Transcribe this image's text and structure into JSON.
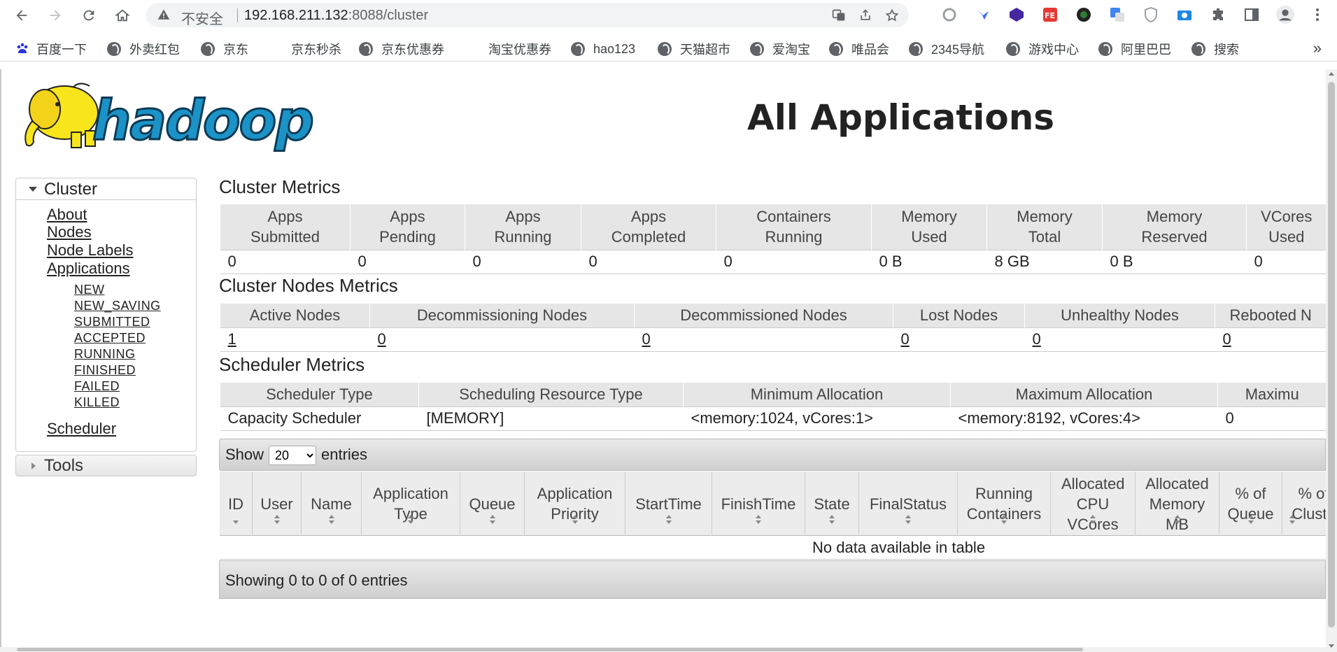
{
  "browser": {
    "security_label": "不安全",
    "url_host": "192.168.211.132",
    "url_rest": ":8088/cluster",
    "bookmarks": [
      {
        "label": "百度一下",
        "icon": "baidu-paw-icon"
      },
      {
        "label": "外卖红包",
        "icon": "globe-icon"
      },
      {
        "label": "京东",
        "icon": "globe-icon"
      },
      {
        "label": "京东秒杀",
        "icon": "none"
      },
      {
        "label": "京东优惠券",
        "icon": "globe-icon"
      },
      {
        "label": "淘宝优惠券",
        "icon": "none"
      },
      {
        "label": "hao123",
        "icon": "globe-icon"
      },
      {
        "label": "天猫超市",
        "icon": "globe-icon"
      },
      {
        "label": "爱淘宝",
        "icon": "globe-icon"
      },
      {
        "label": "唯品会",
        "icon": "globe-icon"
      },
      {
        "label": "2345导航",
        "icon": "globe-icon"
      },
      {
        "label": "游戏中心",
        "icon": "globe-icon"
      },
      {
        "label": "阿里巴巴",
        "icon": "globe-icon"
      },
      {
        "label": "搜索",
        "icon": "globe-icon"
      }
    ],
    "bookmarks_more": "»"
  },
  "page": {
    "logo_text": "hadoop",
    "title": "All Applications"
  },
  "sidebar": {
    "cluster_label": "Cluster",
    "links": [
      "About",
      "Nodes",
      "Node Labels",
      "Applications"
    ],
    "app_states": [
      "NEW",
      "NEW_SAVING",
      "SUBMITTED",
      "ACCEPTED",
      "RUNNING",
      "FINISHED",
      "FAILED",
      "KILLED"
    ],
    "scheduler_link": "Scheduler",
    "tools_label": "Tools"
  },
  "cluster_metrics": {
    "title": "Cluster Metrics",
    "headers": [
      [
        "Apps",
        "Submitted"
      ],
      [
        "Apps",
        "Pending"
      ],
      [
        "Apps",
        "Running"
      ],
      [
        "Apps",
        "Completed"
      ],
      [
        "Containers",
        "Running"
      ],
      [
        "Memory",
        "Used"
      ],
      [
        "Memory",
        "Total"
      ],
      [
        "Memory",
        "Reserved"
      ],
      [
        "VCores",
        "Used"
      ]
    ],
    "values": [
      "0",
      "0",
      "0",
      "0",
      "0",
      "0 B",
      "8 GB",
      "0 B",
      "0"
    ]
  },
  "node_metrics": {
    "title": "Cluster Nodes Metrics",
    "headers": [
      "Active Nodes",
      "Decommissioning Nodes",
      "Decommissioned Nodes",
      "Lost Nodes",
      "Unhealthy Nodes",
      "Rebooted N"
    ],
    "values": [
      "1",
      "0",
      "0",
      "0",
      "0",
      "0"
    ]
  },
  "scheduler_metrics": {
    "title": "Scheduler Metrics",
    "headers": [
      "Scheduler Type",
      "Scheduling Resource Type",
      "Minimum Allocation",
      "Maximum Allocation",
      "Maximu"
    ],
    "values": [
      "Capacity Scheduler",
      "[MEMORY]",
      "<memory:1024, vCores:1>",
      "<memory:8192, vCores:4>",
      "0"
    ]
  },
  "apps_table": {
    "show_label": "Show",
    "entries_label": "entries",
    "page_size": "20",
    "page_size_options": [
      "20"
    ],
    "columns": [
      {
        "label": "ID",
        "sort": "desc"
      },
      {
        "label": "User",
        "sort": "both"
      },
      {
        "label": "Name",
        "sort": "both"
      },
      {
        "label": "Application Type",
        "sort": "both"
      },
      {
        "label": "Queue",
        "sort": "both"
      },
      {
        "label": "Application Priority",
        "sort": "both"
      },
      {
        "label": "StartTime",
        "sort": "both"
      },
      {
        "label": "FinishTime",
        "sort": "both"
      },
      {
        "label": "State",
        "sort": "both"
      },
      {
        "label": "FinalStatus",
        "sort": "both"
      },
      {
        "label": "Running Containers",
        "sort": "both"
      },
      {
        "label": "Allocated CPU VCores",
        "sort": "both"
      },
      {
        "label": "Allocated Memory MB",
        "sort": "both"
      },
      {
        "label": "% of Queue",
        "sort": "both"
      },
      {
        "label": "% of Cluste",
        "sort": "both"
      }
    ],
    "empty_message": "No data available in table",
    "info": "Showing 0 to 0 of 0 entries"
  },
  "colors": {
    "header_bg": "#e6e6e6",
    "logo_blue": "#1b93c7",
    "elephant_yellow": "#f8e51c"
  }
}
